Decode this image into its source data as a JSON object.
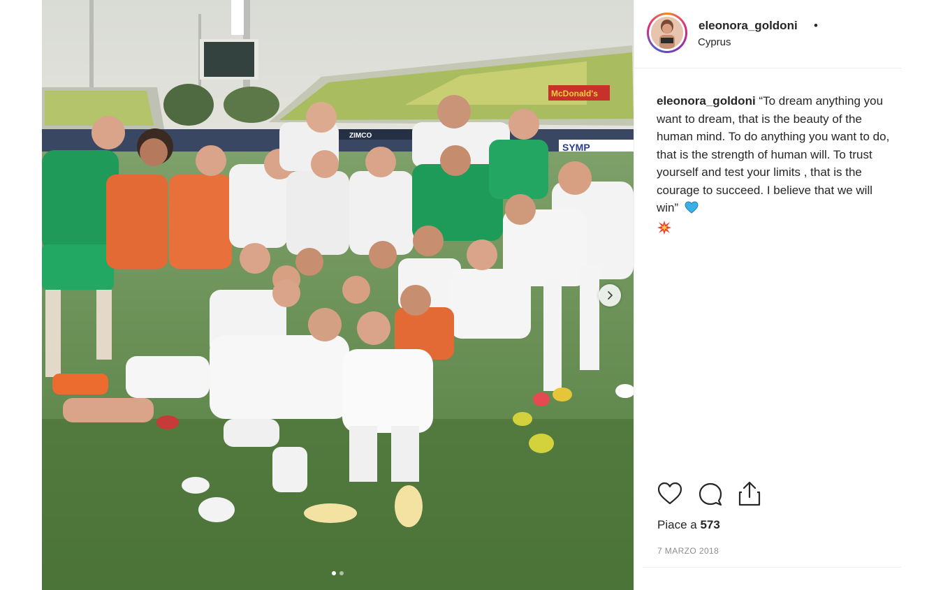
{
  "post": {
    "username": "eleonora_goldoni",
    "bullet": "•",
    "location": "Cyprus",
    "caption_user": "eleonora_goldoni",
    "caption_text": "“To dream anything you want to dream, that is the beauty of the human mind. To do anything you want to do, that is the strength of human will. To trust yourself and test your limits , that is the courage to succeed. I believe that we will win”",
    "likes_prefix": "Piace a ",
    "likes_count": "573",
    "date": "7 MARZO 2018"
  },
  "photo": {
    "sponsor_banner": "McDonald's",
    "board_text": "ZIMCO",
    "board_text_2": "SYMP",
    "carousel_dots": 2,
    "active_dot": 0
  },
  "icons": {
    "like": "heart-icon",
    "comment": "comment-icon",
    "share": "share-icon",
    "next": "chevron-right-icon"
  },
  "colors": {
    "brand_gradient": [
      "#f58529",
      "#dd2a7b",
      "#8134af",
      "#515bd4"
    ],
    "text": "#262626",
    "muted": "#8e8e8e",
    "heart_emoji": "#3ab1e6",
    "boom_emoji": "#e8412c"
  }
}
